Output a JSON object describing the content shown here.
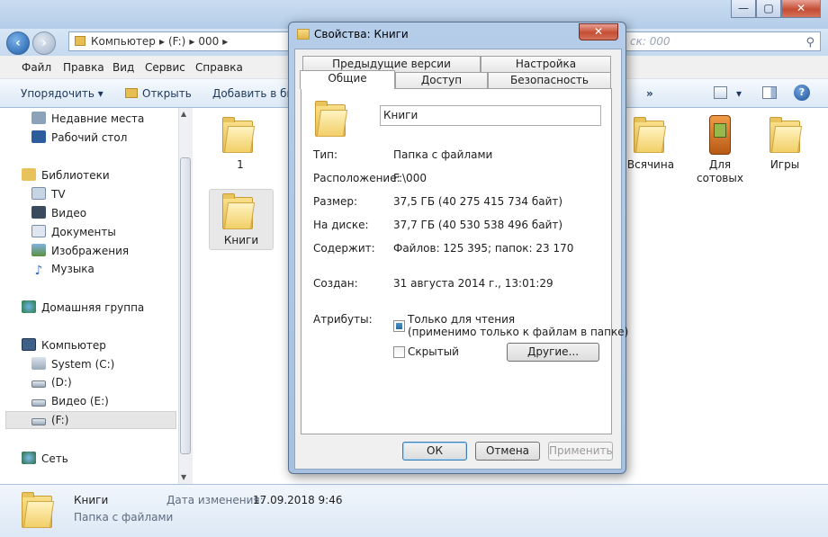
{
  "explorer": {
    "breadcrumb": [
      "Компьютер",
      "▸",
      "(F:)",
      "▸",
      "000",
      "▸"
    ],
    "search_placeholder": "ск: 000",
    "window_buttons": [
      "—",
      "▢",
      "✕"
    ],
    "menu": [
      "Файл",
      "Правка",
      "Вид",
      "Сервис",
      "Справка"
    ],
    "toolbar": {
      "organize": "Упорядочить",
      "open": "Открыть",
      "add_to": "Добавить в биб",
      "more": "»"
    }
  },
  "nav": {
    "recent": "Недавние места",
    "desktop": "Рабочий стол",
    "libraries": "Библиотеки",
    "tv": "TV",
    "video": "Видео",
    "documents": "Документы",
    "images": "Изображения",
    "music": "Музыка",
    "homegroup": "Домашняя группа",
    "computer": "Компьютер",
    "drive_c": "System (C:)",
    "drive_d": "(D:)",
    "drive_e": "Видео (E:)",
    "drive_f": "(F:)",
    "network": "Сеть"
  },
  "files": {
    "item1": "1",
    "item2": "Книги",
    "item3": "Всячина",
    "item4_line1": "Для",
    "item4_line2": "сотовых",
    "item5": "Игры"
  },
  "details": {
    "name": "Книги",
    "type": "Папка с файлами",
    "date_label": "Дата изменения:",
    "date": "17.09.2018 9:46"
  },
  "dialog": {
    "title": "Свойства: Книги",
    "close": "✕",
    "tabs": {
      "previous_versions": "Предыдущие версии",
      "settings": "Настройка",
      "general": "Общие",
      "access": "Доступ",
      "security": "Безопасность"
    },
    "folder_name": "Книги",
    "type_label": "Тип:",
    "type_value": "Папка с файлами",
    "location_label": "Расположение:",
    "location_value": "F:\\000",
    "size_label": "Размер:",
    "size_value": "37,5 ГБ (40 275 415 734 байт)",
    "on_disk_label": "На диске:",
    "on_disk_value": "37,7 ГБ (40 530 538 496 байт)",
    "contains_label": "Содержит:",
    "contains_value": "Файлов: 125 395; папок: 23 170",
    "created_label": "Создан:",
    "created_value": "31 августа 2014 г., 13:01:29",
    "attributes_label": "Атрибуты:",
    "readonly_label": "Только для чтения",
    "readonly_note": "(применимо только к файлам в папке)",
    "hidden_label": "Скрытый",
    "other_button": "Другие...",
    "ok": "ОК",
    "cancel": "Отмена",
    "apply": "Применить"
  }
}
